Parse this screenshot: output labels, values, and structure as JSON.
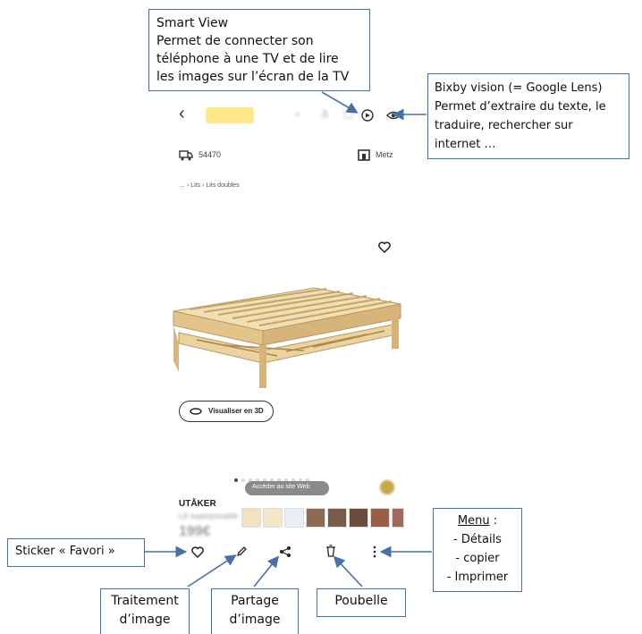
{
  "callouts": {
    "smart_view": {
      "title": "Smart View",
      "line1": "Permet de connecter son",
      "line2": "téléphone à une TV et de lire",
      "line3": "les images sur l’écran de la TV"
    },
    "bixby": {
      "line1": "Bixby vision (= Google Lens)",
      "line2": "Permet d’extraire du texte, le",
      "line3": "traduire, rechercher sur",
      "line4": "internet …"
    },
    "sticker": {
      "text": "Sticker « Favori »"
    },
    "menu": {
      "title": "Menu",
      "sep": " :",
      "item1": "- Détails",
      "item2": "- copier",
      "item3": "- Imprimer"
    },
    "traitement": {
      "line1": "Traitement",
      "line2": "d’image"
    },
    "partage": {
      "line1": "Partage",
      "line2": "d’image"
    },
    "poubelle": {
      "text": "Poubelle"
    }
  },
  "screen": {
    "postcode": "54470",
    "store": "Metz",
    "breadcrumb": "… › Lits › Lits doubles",
    "view3d_label": "Visualiser en 3D",
    "site_button": "Accéder au site Web",
    "product_name": "UTÅKER",
    "product_sub": "Lit superposable",
    "price": "199€",
    "icons": {
      "back": "chevron-left-icon",
      "smart_view": "smart-view-icon",
      "bixby": "eye-icon",
      "truck": "truck-icon",
      "store": "store-icon",
      "heart": "heart-icon",
      "rotate": "rotate-3d-icon",
      "edit": "pencil-icon",
      "share": "share-icon",
      "delete": "trash-icon",
      "more": "more-vertical-icon"
    }
  },
  "colors": {
    "callout_border": "#4a6fa5",
    "arrow": "#4a6fa5",
    "wood": "#e8cf9a",
    "ikea_yellow": "#ffd31a"
  }
}
